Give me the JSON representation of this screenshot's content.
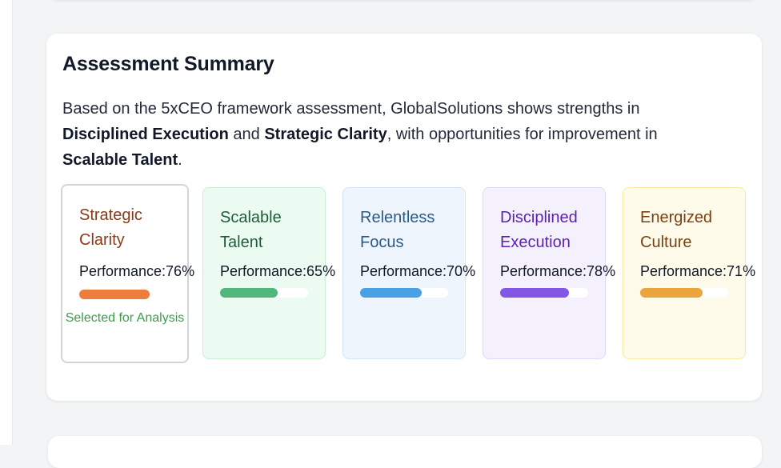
{
  "summary_card": {
    "title": "Assessment Summary",
    "summary": {
      "part1": "Based on the 5xCEO framework assessment, GlobalSolutions shows strengths in ",
      "strength1": "Disciplined Execution",
      "part2": " and ",
      "strength2": "Strategic Clarity",
      "part3": ", with opportunities for improvement in ",
      "improvement": "Scalable Talent",
      "part4": "."
    },
    "pillars": [
      {
        "name": "Strategic Clarity",
        "performance_label": "Performance:",
        "performance_value": "76%",
        "performance": 0.76,
        "selected": true,
        "selected_note": "Selected for Analysis",
        "colors": {
          "name": "#8a3a16",
          "bar": "#ed7d3a",
          "bg": "#ffffff",
          "border": "#d1d5db"
        }
      },
      {
        "name": "Scalable Talent",
        "performance_label": "Performance:",
        "performance_value": "65%",
        "performance": 0.65,
        "selected": false,
        "colors": {
          "name": "#1f5c3a",
          "bar": "#4fb87a",
          "bg": "#ecfbf1",
          "border": "#c9f0d5"
        }
      },
      {
        "name": "Relentless Focus",
        "performance_label": "Performance:",
        "performance_value": "70%",
        "performance": 0.7,
        "selected": false,
        "colors": {
          "name": "#2c5a88",
          "bar": "#4aa0e4",
          "bg": "#eef5fd",
          "border": "#d3e4f7"
        }
      },
      {
        "name": "Disciplined Execution",
        "performance_label": "Performance:",
        "performance_value": "78%",
        "performance": 0.78,
        "selected": false,
        "colors": {
          "name": "#5b21b6",
          "bar": "#8257e6",
          "bg": "#f4f1fd",
          "border": "#e0d8f8"
        }
      },
      {
        "name": "Energized Culture",
        "performance_label": "Performance:",
        "performance_value": "71%",
        "performance": 0.71,
        "selected": false,
        "colors": {
          "name": "#7c3f12",
          "bar": "#eca43c",
          "bg": "#fffbea",
          "border": "#fbe7a6"
        }
      }
    ]
  }
}
